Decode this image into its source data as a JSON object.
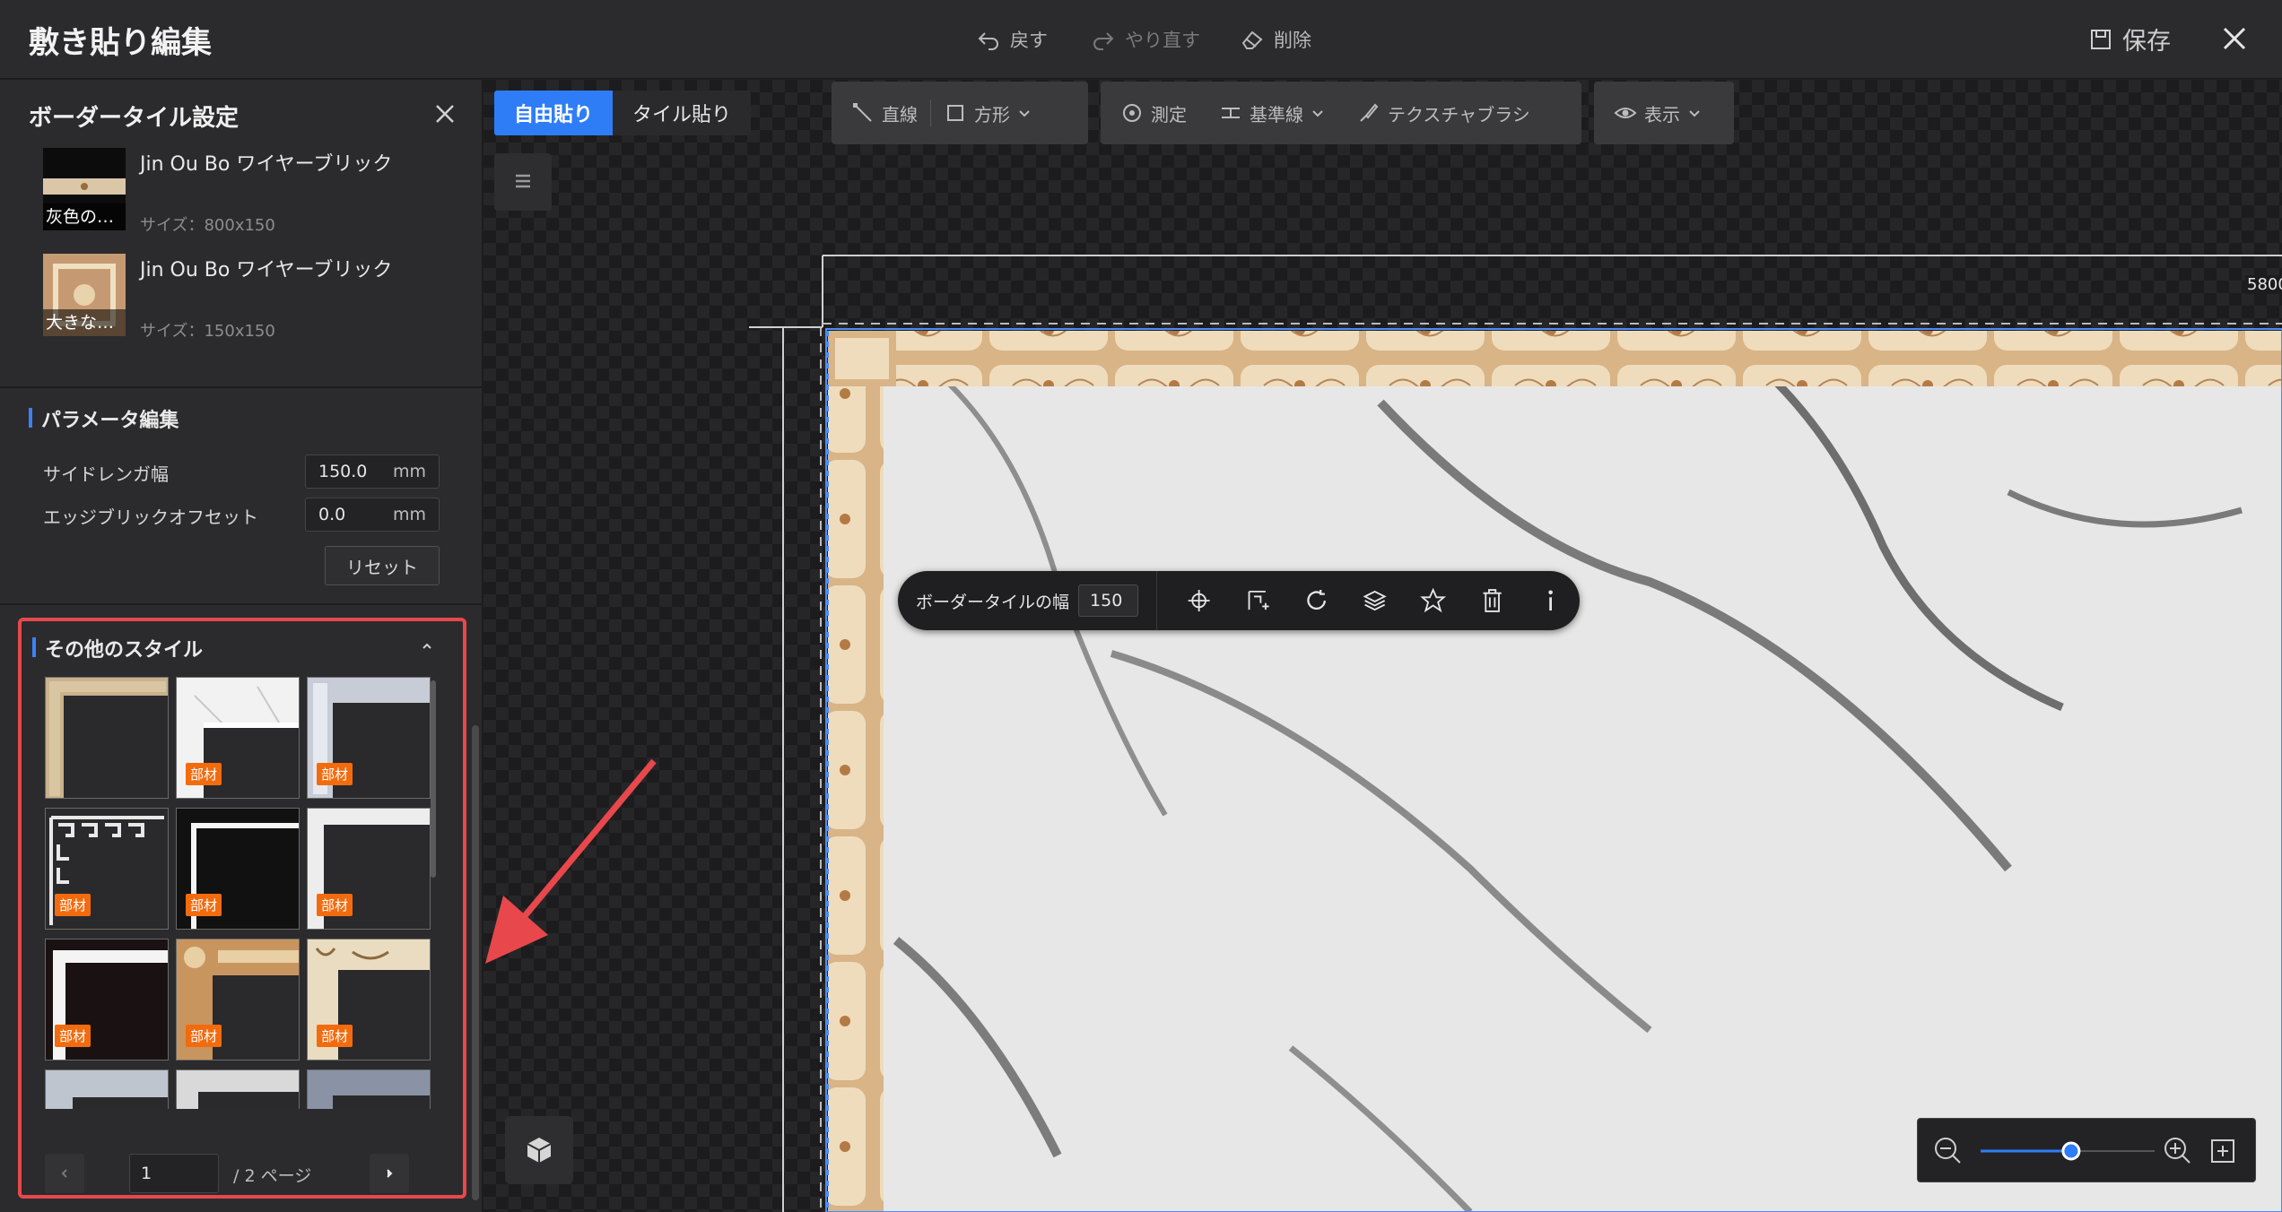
{
  "window": {
    "title": "敷き貼り編集",
    "undo_label": "戻す",
    "redo_label": "やり直す",
    "delete_label": "削除",
    "save_label": "保存"
  },
  "left_panel": {
    "title": "ボーダータイル設定",
    "tiles": [
      {
        "name": "Jin Ou Bo ワイヤーブリック",
        "caption": "灰色の…",
        "size": "サイズ：800x150"
      },
      {
        "name": "Jin Ou Bo ワイヤーブリック",
        "caption": "大きな…",
        "size": "サイズ：150x150"
      }
    ],
    "params": {
      "title": "パラメータ編集",
      "side_brick_width_label": "サイドレンガ幅",
      "side_brick_width_value": "150.0",
      "edge_offset_label": "エッジブリックオフセット",
      "edge_offset_value": "0.0",
      "unit": "mm",
      "reset_label": "リセット"
    },
    "styles": {
      "title": "その他のスタイル",
      "badge": "部材",
      "current_page": "1",
      "total_pages_label": "/ 2 ページ"
    }
  },
  "canvas": {
    "mode_free": "自由貼り",
    "mode_tile": "タイル貼り",
    "tools": {
      "line": "直線",
      "rect": "方形",
      "measure": "測定",
      "baseline": "基準線",
      "texture_brush": "テクスチャブラシ",
      "display": "表示"
    },
    "ruler_value": "5800",
    "floating_toolbar": {
      "width_label": "ボーダータイルの幅",
      "width_value": "150"
    },
    "zoom_level": 0.52
  },
  "colors": {
    "accent": "#2f7df6",
    "badge": "#f26b0f",
    "highlight_border": "#e8484b",
    "arrow": "#e8484b"
  }
}
